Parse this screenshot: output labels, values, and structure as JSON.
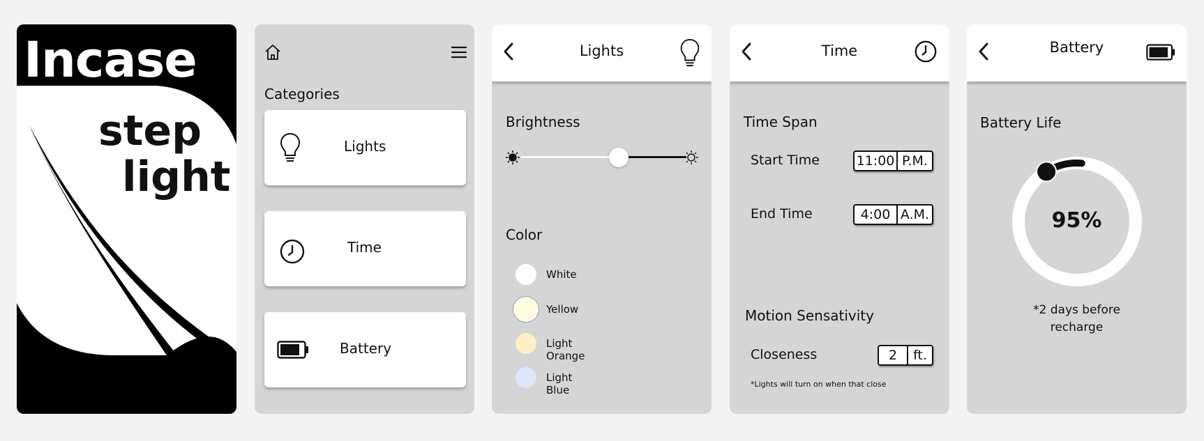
{
  "splash": {
    "brand": "Incase",
    "tagline_line1": "step",
    "tagline_line2": "light"
  },
  "home": {
    "section_title": "Categories",
    "categories": [
      {
        "label": "Lights",
        "icon": "lightbulb-icon"
      },
      {
        "label": "Time",
        "icon": "clock-icon"
      },
      {
        "label": "Battery",
        "icon": "battery-icon"
      }
    ]
  },
  "lights": {
    "title": "Lights",
    "brightness_title": "Brightness",
    "brightness_level": 0.59,
    "color_title": "Color",
    "colors": [
      {
        "label": "White",
        "hex": "#ffffff",
        "selected": false
      },
      {
        "label": "Yellow",
        "hex": "#fdfbe0",
        "selected": true
      },
      {
        "label": "Light Orange",
        "hex": "#fdefc5",
        "selected": false
      },
      {
        "label": "Light Blue",
        "hex": "#dfe6f8",
        "selected": false
      }
    ]
  },
  "time": {
    "title": "Time",
    "span_title": "Time Span",
    "start_label": "Start Time",
    "start_value": "11:00",
    "start_period": "P.M.",
    "end_label": "End Time",
    "end_value": "4:00",
    "end_period": "A.M.",
    "motion_title": "Motion Sensativity",
    "closeness_label": "Closeness",
    "closeness_value": "2",
    "closeness_unit": "ft.",
    "note": "*Lights will turn on when that close"
  },
  "battery": {
    "title": "Battery",
    "life_title": "Battery Life",
    "percent": 95,
    "percent_label": "95%",
    "recharge_line1": "*2 days before",
    "recharge_line2": "recharge"
  }
}
